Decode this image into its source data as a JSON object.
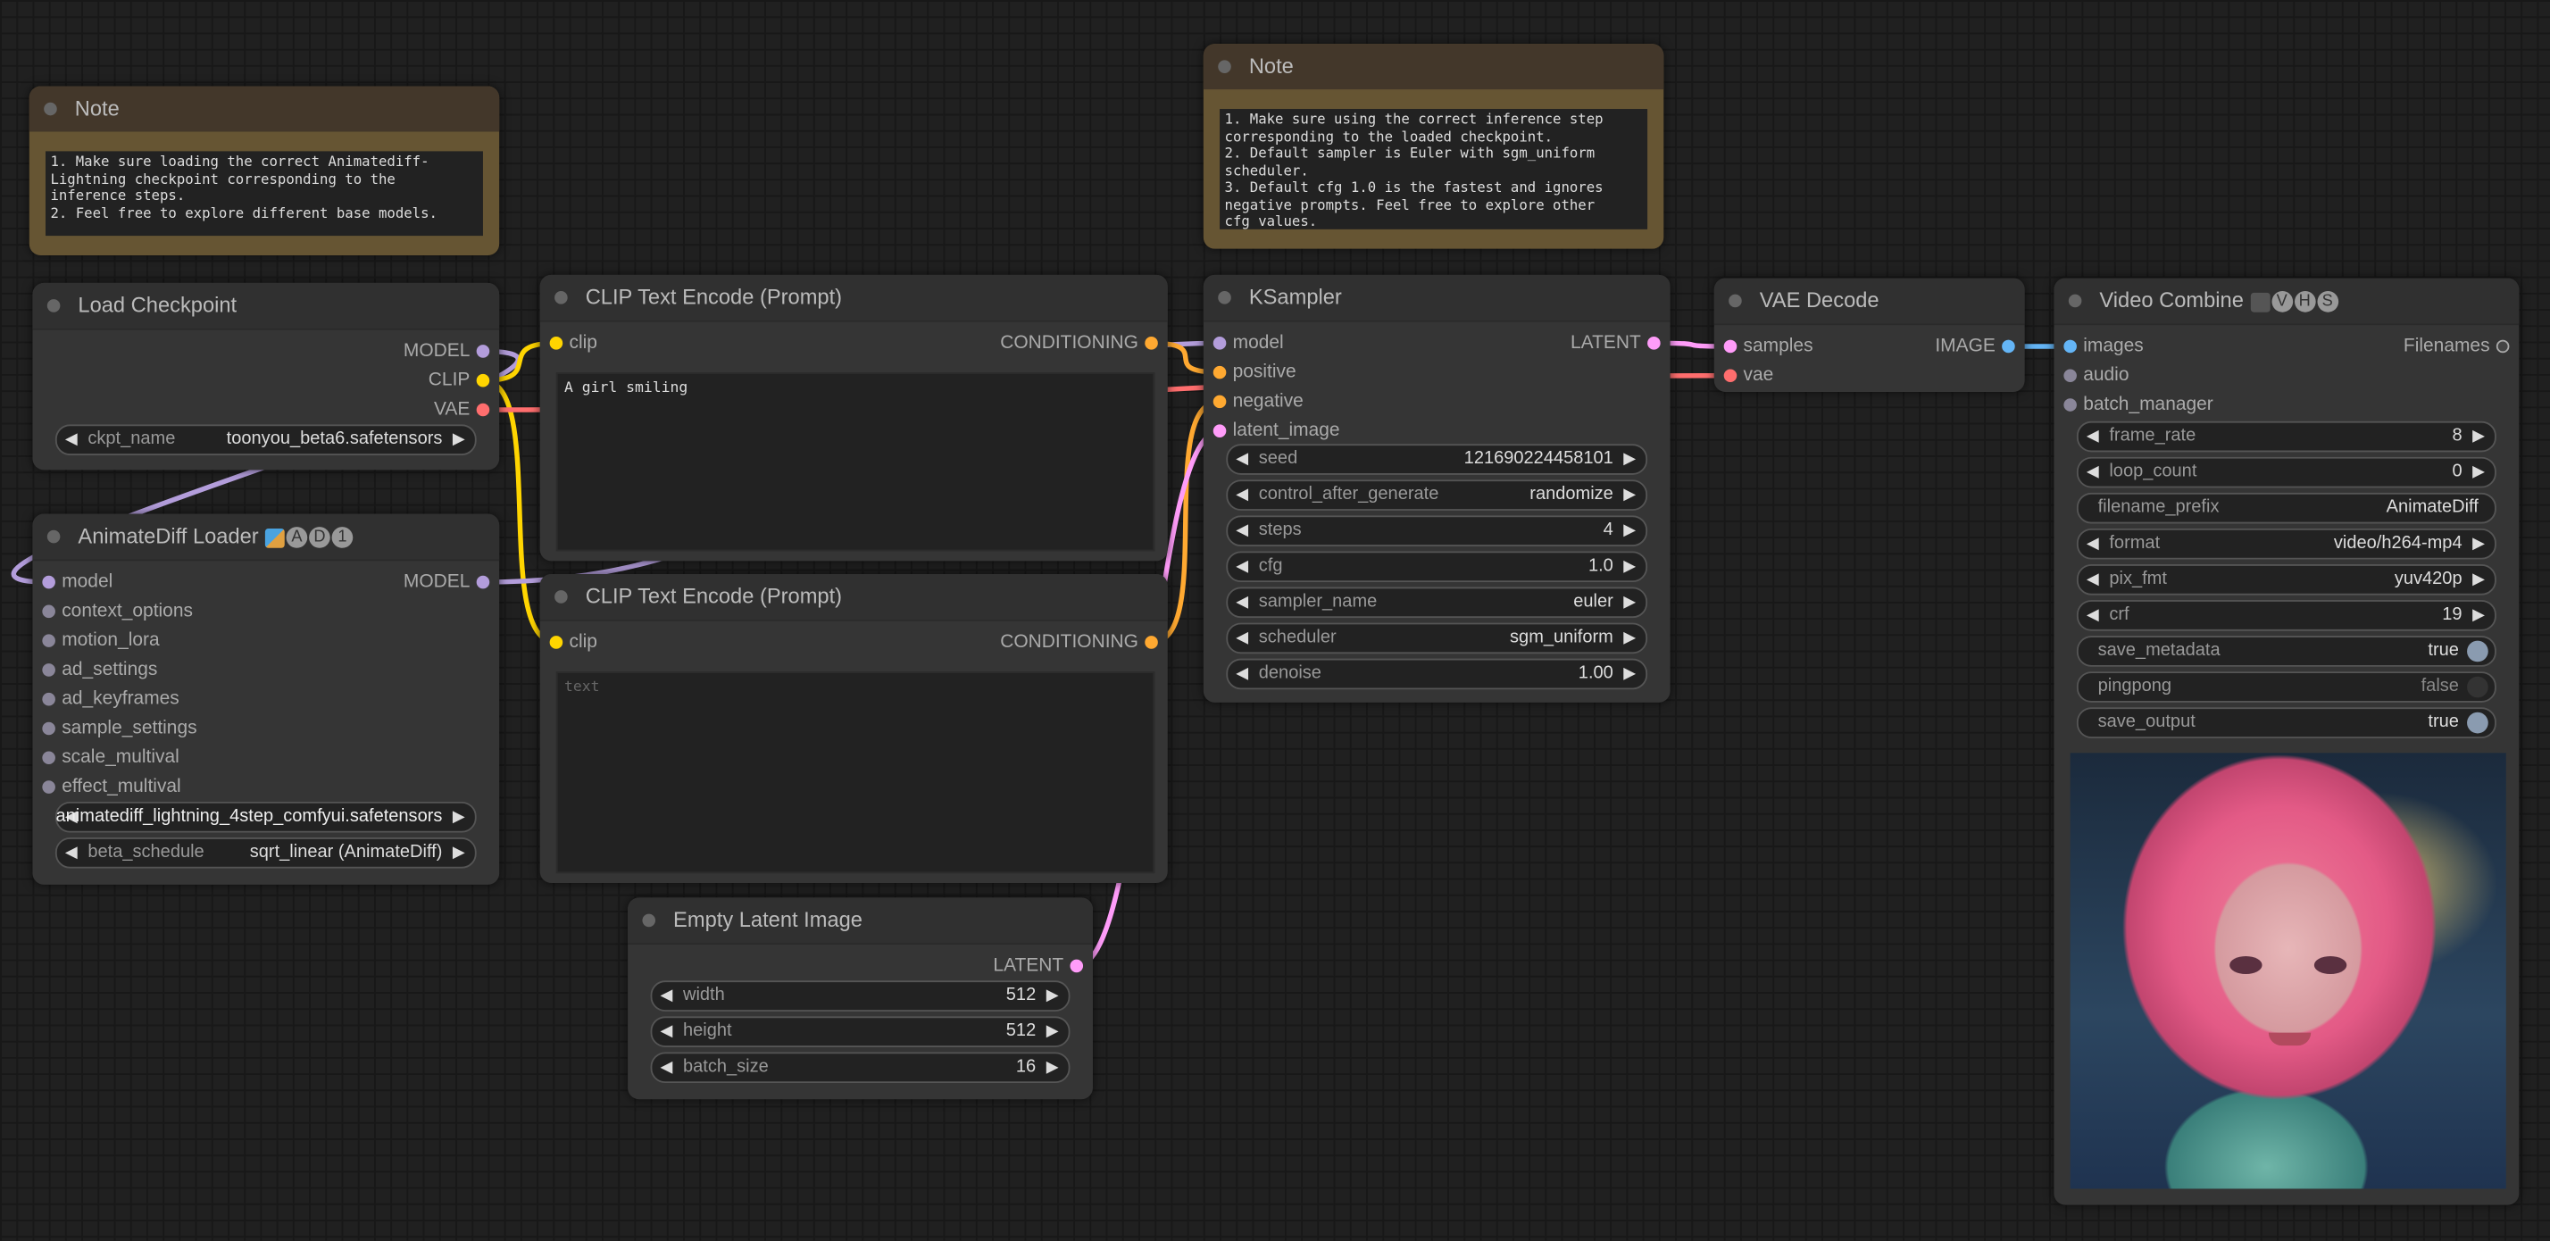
{
  "colors": {
    "MODEL": "#b39ddb",
    "CLIP": "#ffd500",
    "VAE": "#ff6e6e",
    "CONDITIONING": "#ffa931",
    "LATENT": "#ff9cf9",
    "IMAGE": "#64b5f6",
    "generic": "#8a8699"
  },
  "nodes": {
    "note1": {
      "title": "Note",
      "text": "1. Make sure loading the correct Animatediff-\nLightning checkpoint corresponding to the\ninference steps.\n2. Feel free to explore different base models."
    },
    "note2": {
      "title": "Note",
      "text": "1. Make sure using the correct inference step\ncorresponding to the loaded checkpoint.\n2. Default sampler is Euler with sgm_uniform\nscheduler.\n3. Default cfg 1.0 is the fastest and ignores\nnegative prompts. Feel free to explore other\ncfg values."
    },
    "ckpt": {
      "title": "Load Checkpoint",
      "inputs": [],
      "outputs": [
        {
          "label": "MODEL",
          "type": "MODEL"
        },
        {
          "label": "CLIP",
          "type": "CLIP"
        },
        {
          "label": "VAE",
          "type": "VAE"
        }
      ],
      "widgets": [
        {
          "kind": "combo",
          "label": "ckpt_name",
          "value": "toonyou_beta6.safetensors"
        }
      ]
    },
    "animatediff": {
      "title": "AnimateDiff Loader",
      "badges": [
        "A",
        "D",
        "1"
      ],
      "emoji": "theater-masks-icon",
      "inputs": [
        {
          "label": "model",
          "type": "MODEL"
        },
        {
          "label": "context_options"
        },
        {
          "label": "motion_lora"
        },
        {
          "label": "ad_settings"
        },
        {
          "label": "ad_keyframes"
        },
        {
          "label": "sample_settings"
        },
        {
          "label": "scale_multival"
        },
        {
          "label": "effect_multival"
        }
      ],
      "outputs": [
        {
          "label": "MODEL",
          "type": "MODEL"
        }
      ],
      "widgets": [
        {
          "kind": "combo",
          "label": "model_name",
          "value": "animatediff_lightning_4step_comfyui.safetensors"
        },
        {
          "kind": "combo",
          "label": "beta_schedule",
          "value": "sqrt_linear (AnimateDiff)"
        }
      ]
    },
    "clip1": {
      "title": "CLIP Text Encode (Prompt)",
      "inputs": [
        {
          "label": "clip",
          "type": "CLIP"
        }
      ],
      "outputs": [
        {
          "label": "CONDITIONING",
          "type": "CONDITIONING"
        }
      ],
      "text": "A girl smiling",
      "placeholder": ""
    },
    "clip2": {
      "title": "CLIP Text Encode (Prompt)",
      "inputs": [
        {
          "label": "clip",
          "type": "CLIP"
        }
      ],
      "outputs": [
        {
          "label": "CONDITIONING",
          "type": "CONDITIONING"
        }
      ],
      "text": "",
      "placeholder": "text"
    },
    "latent": {
      "title": "Empty Latent Image",
      "inputs": [],
      "outputs": [
        {
          "label": "LATENT",
          "type": "LATENT"
        }
      ],
      "widgets": [
        {
          "kind": "number",
          "label": "width",
          "value": "512"
        },
        {
          "kind": "number",
          "label": "height",
          "value": "512"
        },
        {
          "kind": "number",
          "label": "batch_size",
          "value": "16"
        }
      ]
    },
    "ksampler": {
      "title": "KSampler",
      "inputs": [
        {
          "label": "model",
          "type": "MODEL"
        },
        {
          "label": "positive",
          "type": "CONDITIONING"
        },
        {
          "label": "negative",
          "type": "CONDITIONING"
        },
        {
          "label": "latent_image",
          "type": "LATENT"
        }
      ],
      "outputs": [
        {
          "label": "LATENT",
          "type": "LATENT"
        }
      ],
      "widgets": [
        {
          "kind": "number",
          "label": "seed",
          "value": "121690224458101"
        },
        {
          "kind": "combo",
          "label": "control_after_generate",
          "value": "randomize"
        },
        {
          "kind": "number",
          "label": "steps",
          "value": "4"
        },
        {
          "kind": "number",
          "label": "cfg",
          "value": "1.0"
        },
        {
          "kind": "combo",
          "label": "sampler_name",
          "value": "euler"
        },
        {
          "kind": "combo",
          "label": "scheduler",
          "value": "sgm_uniform"
        },
        {
          "kind": "number",
          "label": "denoise",
          "value": "1.00"
        }
      ]
    },
    "vaedecode": {
      "title": "VAE Decode",
      "inputs": [
        {
          "label": "samples",
          "type": "LATENT"
        },
        {
          "label": "vae",
          "type": "VAE"
        }
      ],
      "outputs": [
        {
          "label": "IMAGE",
          "type": "IMAGE"
        }
      ],
      "widgets": []
    },
    "videocombine": {
      "title": "Video Combine",
      "badges": [
        "V",
        "H",
        "S"
      ],
      "emoji": "film-camera-icon",
      "inputs": [
        {
          "label": "images",
          "type": "IMAGE"
        },
        {
          "label": "audio"
        },
        {
          "label": "batch_manager"
        }
      ],
      "outputs": [
        {
          "label": "Filenames"
        }
      ],
      "widgets": [
        {
          "kind": "number",
          "label": "frame_rate",
          "value": "8"
        },
        {
          "kind": "number",
          "label": "loop_count",
          "value": "0"
        },
        {
          "kind": "text",
          "label": "filename_prefix",
          "value": "AnimateDiff"
        },
        {
          "kind": "combo",
          "label": "format",
          "value": "video/h264-mp4"
        },
        {
          "kind": "combo",
          "label": "pix_fmt",
          "value": "yuv420p"
        },
        {
          "kind": "number",
          "label": "crf",
          "value": "19"
        },
        {
          "kind": "toggle",
          "label": "save_metadata",
          "value": "true",
          "on": true
        },
        {
          "kind": "toggle",
          "label": "pingpong",
          "value": "false",
          "on": false
        },
        {
          "kind": "toggle",
          "label": "save_output",
          "value": "true",
          "on": true
        }
      ],
      "preview": "animated-girl-preview-image"
    }
  }
}
